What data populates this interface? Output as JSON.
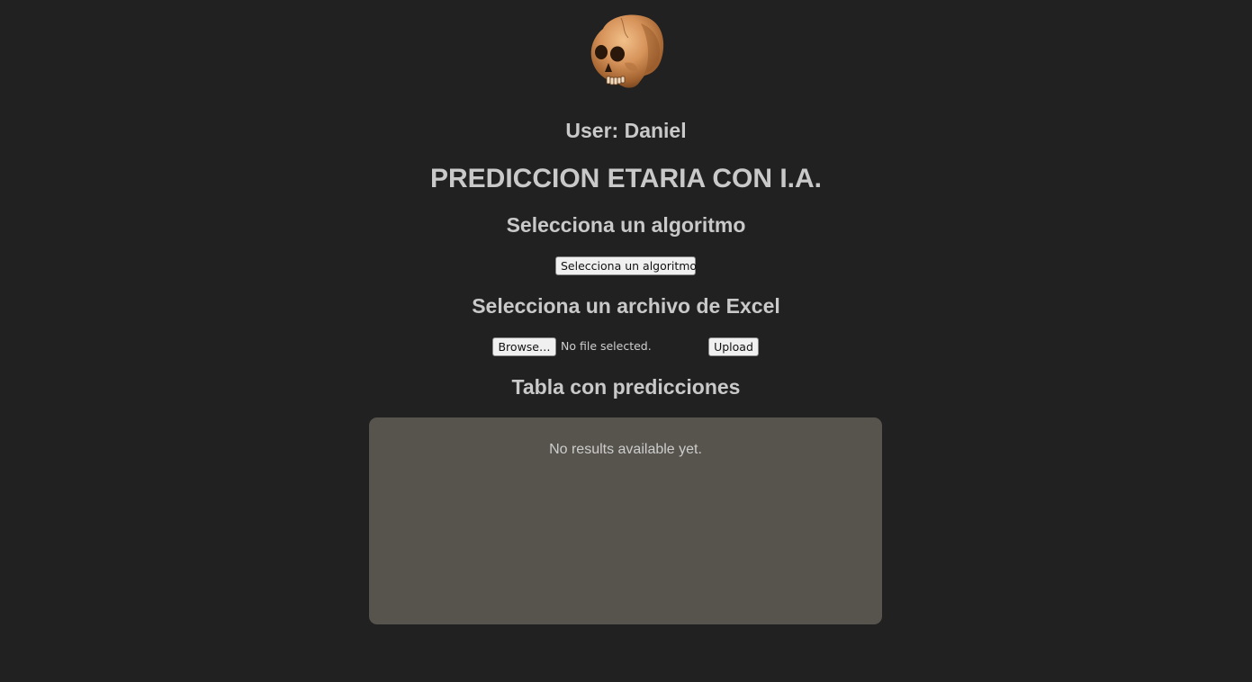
{
  "header": {
    "logo_icon": "skull-icon",
    "user_label": "User: Daniel",
    "title": "PREDICCION ETARIA CON I.A."
  },
  "algorithm_section": {
    "heading": "Selecciona un algoritmo",
    "button_label": "Selecciona un algoritmo"
  },
  "file_section": {
    "heading": "Selecciona un archivo de Excel",
    "browse_label": "Browse…",
    "file_status": "No file selected.",
    "upload_label": "Upload"
  },
  "results_section": {
    "heading": "Tabla con predicciones",
    "empty_message": "No results available yet."
  },
  "colors": {
    "background": "#212121",
    "text": "#c9c9c9",
    "panel": "#57544d"
  }
}
